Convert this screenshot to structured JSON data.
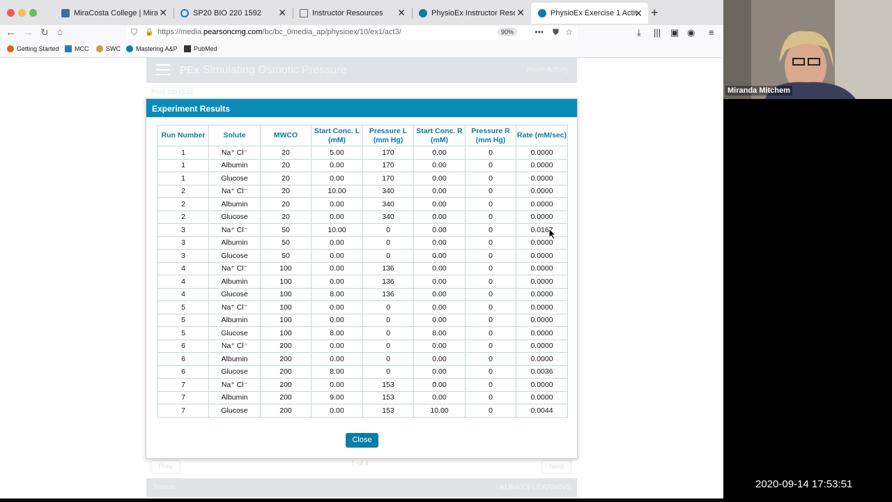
{
  "tabs": [
    {
      "label": "MiraCosta College | MiraCosta",
      "active": false
    },
    {
      "label": "SP20 BIO 220 1592",
      "active": false
    },
    {
      "label": "Instructor Resources",
      "active": false
    },
    {
      "label": "PhysioEx Instructor Resources",
      "active": false
    },
    {
      "label": "PhysioEx Exercise 1 Activity 3",
      "active": true
    }
  ],
  "url": {
    "prefix": "https://media.",
    "domain": "pearsoncmg.com",
    "path": "/bc/bc_0media_ap/physioex/10/ex1/act3/",
    "zoom": "90%"
  },
  "bookmarks": [
    "Getting Started",
    "MCC",
    "SWC",
    "Mastering A&P",
    "PubMed"
  ],
  "app": {
    "logo": "PEx",
    "title": "Simulating Osmotic Pressure",
    "reset": "Reset Activity",
    "postlab": "Post-lab Quiz",
    "prev": "Prev",
    "next": "Next",
    "page_count": "1 of 4",
    "footer_brand": "Pearson",
    "footer_tagline": "ALWAYS LEARNING"
  },
  "modal": {
    "title": "Experiment Results",
    "close_label": "Close",
    "columns": [
      "Run Number",
      "Solute",
      "MWCO",
      "Start Conc. L (mM)",
      "Pressure L (mm Hg)",
      "Start Conc. R (mM)",
      "Pressure R (mm Hg)",
      "Rate (mM/sec)"
    ],
    "rows": [
      [
        "1",
        "Na⁺ Cl⁻",
        "20",
        "5.00",
        "170",
        "0.00",
        "0",
        "0.0000"
      ],
      [
        "1",
        "Albumin",
        "20",
        "0.00",
        "170",
        "0.00",
        "0",
        "0.0000"
      ],
      [
        "1",
        "Glucose",
        "20",
        "0.00",
        "170",
        "0.00",
        "0",
        "0.0000"
      ],
      [
        "2",
        "Na⁺ Cl⁻",
        "20",
        "10.00",
        "340",
        "0.00",
        "0",
        "0.0000"
      ],
      [
        "2",
        "Albumin",
        "20",
        "0.00",
        "340",
        "0.00",
        "0",
        "0.0000"
      ],
      [
        "2",
        "Glucose",
        "20",
        "0.00",
        "340",
        "0.00",
        "0",
        "0.0000"
      ],
      [
        "3",
        "Na⁺ Cl⁻",
        "50",
        "10.00",
        "0",
        "0.00",
        "0",
        "0.0167"
      ],
      [
        "3",
        "Albumin",
        "50",
        "0.00",
        "0",
        "0.00",
        "0",
        "0.0000"
      ],
      [
        "3",
        "Glucose",
        "50",
        "0.00",
        "0",
        "0.00",
        "0",
        "0.0000"
      ],
      [
        "4",
        "Na⁺ Cl⁻",
        "100",
        "0.00",
        "136",
        "0.00",
        "0",
        "0.0000"
      ],
      [
        "4",
        "Albumin",
        "100",
        "0.00",
        "136",
        "0.00",
        "0",
        "0.0000"
      ],
      [
        "4",
        "Glucose",
        "100",
        "8.00",
        "136",
        "0.00",
        "0",
        "0.0000"
      ],
      [
        "5",
        "Na⁺ Cl⁻",
        "100",
        "0.00",
        "0",
        "0.00",
        "0",
        "0.0000"
      ],
      [
        "5",
        "Albumin",
        "100",
        "0.00",
        "0",
        "0.00",
        "0",
        "0.0000"
      ],
      [
        "5",
        "Glucose",
        "100",
        "8.00",
        "0",
        "8.00",
        "0",
        "0.0000"
      ],
      [
        "6",
        "Na⁺ Cl⁻",
        "200",
        "0.00",
        "0",
        "0.00",
        "0",
        "0.0000"
      ],
      [
        "6",
        "Albumin",
        "200",
        "0.00",
        "0",
        "0.00",
        "0",
        "0.0000"
      ],
      [
        "6",
        "Glucose",
        "200",
        "8.00",
        "0",
        "0.00",
        "0",
        "0.0036"
      ],
      [
        "7",
        "Na⁺ Cl⁻",
        "200",
        "0.00",
        "153",
        "0.00",
        "0",
        "0.0000"
      ],
      [
        "7",
        "Albumin",
        "200",
        "9.00",
        "153",
        "0.00",
        "0",
        "0.0000"
      ],
      [
        "7",
        "Glucose",
        "200",
        "0.00",
        "153",
        "10.00",
        "0",
        "0.0044"
      ]
    ]
  },
  "video": {
    "participant": "Miranda Mitchem"
  },
  "timestamp": "2020-09-14  17:53:51",
  "colors": {
    "accent": "#0b8cb8",
    "header_text": "#0c79a6",
    "button": "#0b7da6"
  }
}
